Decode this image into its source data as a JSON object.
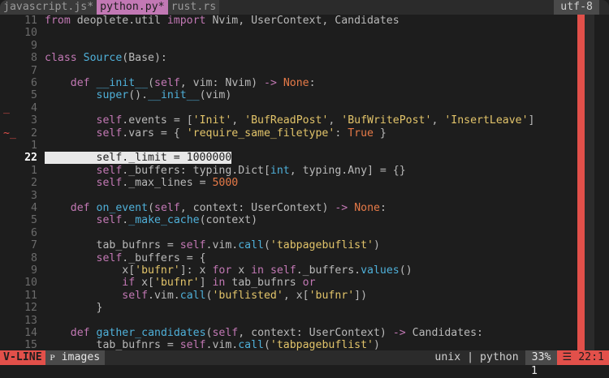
{
  "tabs": [
    {
      "label": "javascript.js",
      "modified": "*"
    },
    {
      "label": "python.py",
      "modified": "*"
    },
    {
      "label": "rust.rs",
      "modified": ""
    }
  ],
  "encoding": "utf-8",
  "lines": [
    {
      "num": "11",
      "sign": "",
      "tokens": [
        [
          "k",
          "from"
        ],
        [
          "o",
          " deoplete.util "
        ],
        [
          "k",
          "import"
        ],
        [
          "o",
          " Nvim, UserContext, Candidates"
        ]
      ]
    },
    {
      "num": "10",
      "sign": "",
      "tokens": []
    },
    {
      "num": "9",
      "sign": "",
      "tokens": []
    },
    {
      "num": "8",
      "sign": "",
      "tokens": [
        [
          "k",
          "class"
        ],
        [
          "o",
          " "
        ],
        [
          "f",
          "Source"
        ],
        [
          "o",
          "(Base):"
        ]
      ]
    },
    {
      "num": "7",
      "sign": "",
      "tokens": []
    },
    {
      "num": "6",
      "sign": "",
      "tokens": [
        [
          "o",
          "    "
        ],
        [
          "k",
          "def"
        ],
        [
          "o",
          " "
        ],
        [
          "f",
          "__init__"
        ],
        [
          "o",
          "("
        ],
        [
          "k",
          "self"
        ],
        [
          "o",
          ", vim: Nvim) "
        ],
        [
          "k",
          "->"
        ],
        [
          "o",
          " "
        ],
        [
          "c",
          "None"
        ],
        [
          "o",
          ":"
        ]
      ]
    },
    {
      "num": "5",
      "sign": "",
      "tokens": [
        [
          "o",
          "        "
        ],
        [
          "f",
          "super"
        ],
        [
          "o",
          "()."
        ],
        [
          "f",
          "__init__"
        ],
        [
          "o",
          "(vim)"
        ]
      ]
    },
    {
      "num": "4",
      "sign": "_",
      "tokens": []
    },
    {
      "num": "3",
      "sign": "",
      "tokens": [
        [
          "o",
          "        "
        ],
        [
          "k",
          "self"
        ],
        [
          "o",
          ".events = ["
        ],
        [
          "s",
          "'Init'"
        ],
        [
          "o",
          ", "
        ],
        [
          "s",
          "'BufReadPost'"
        ],
        [
          "o",
          ", "
        ],
        [
          "s",
          "'BufWritePost'"
        ],
        [
          "o",
          ", "
        ],
        [
          "s",
          "'InsertLeave'"
        ],
        [
          "o",
          "]"
        ]
      ]
    },
    {
      "num": "2",
      "sign": "~_",
      "tokens": [
        [
          "o",
          "        "
        ],
        [
          "k",
          "self"
        ],
        [
          "o",
          ".vars = { "
        ],
        [
          "s",
          "'require_same_filetype'"
        ],
        [
          "o",
          ": "
        ],
        [
          "c",
          "True"
        ],
        [
          "o",
          " }"
        ]
      ]
    },
    {
      "num": "1",
      "sign": "",
      "tokens": []
    },
    {
      "num": "22",
      "sign": "",
      "current": true,
      "tokens": [
        [
          "sel",
          "        self._limit = 1000000"
        ]
      ]
    },
    {
      "num": "1",
      "sign": "",
      "tokens": [
        [
          "o",
          "        "
        ],
        [
          "k",
          "self"
        ],
        [
          "o",
          "._buffers: typing.Dict["
        ],
        [
          "f",
          "int"
        ],
        [
          "o",
          ", typing.Any] = {}"
        ]
      ]
    },
    {
      "num": "2",
      "sign": "",
      "tokens": [
        [
          "o",
          "        "
        ],
        [
          "k",
          "self"
        ],
        [
          "o",
          "._max_lines = "
        ],
        [
          "c",
          "5000"
        ]
      ]
    },
    {
      "num": "3",
      "sign": "",
      "tokens": []
    },
    {
      "num": "4",
      "sign": "",
      "tokens": [
        [
          "o",
          "    "
        ],
        [
          "k",
          "def"
        ],
        [
          "o",
          " "
        ],
        [
          "f",
          "on_event"
        ],
        [
          "o",
          "("
        ],
        [
          "k",
          "self"
        ],
        [
          "o",
          ", context: UserContext) "
        ],
        [
          "k",
          "->"
        ],
        [
          "o",
          " "
        ],
        [
          "c",
          "None"
        ],
        [
          "o",
          ":"
        ]
      ]
    },
    {
      "num": "5",
      "sign": "",
      "tokens": [
        [
          "o",
          "        "
        ],
        [
          "k",
          "self"
        ],
        [
          "o",
          "."
        ],
        [
          "f",
          "_make_cache"
        ],
        [
          "o",
          "(context)"
        ]
      ]
    },
    {
      "num": "6",
      "sign": "",
      "tokens": []
    },
    {
      "num": "7",
      "sign": "",
      "tokens": [
        [
          "o",
          "        tab_bufnrs = "
        ],
        [
          "k",
          "self"
        ],
        [
          "o",
          ".vim."
        ],
        [
          "f",
          "call"
        ],
        [
          "o",
          "("
        ],
        [
          "s",
          "'tabpagebuflist'"
        ],
        [
          "o",
          ")"
        ]
      ]
    },
    {
      "num": "8",
      "sign": "",
      "tokens": [
        [
          "o",
          "        "
        ],
        [
          "k",
          "self"
        ],
        [
          "o",
          "._buffers = {"
        ]
      ]
    },
    {
      "num": "9",
      "sign": "",
      "tokens": [
        [
          "o",
          "            x["
        ],
        [
          "s",
          "'bufnr'"
        ],
        [
          "o",
          "]: x "
        ],
        [
          "k",
          "for"
        ],
        [
          "o",
          " x "
        ],
        [
          "k",
          "in"
        ],
        [
          "o",
          " "
        ],
        [
          "k",
          "self"
        ],
        [
          "o",
          "._buffers."
        ],
        [
          "f",
          "values"
        ],
        [
          "o",
          "()"
        ]
      ]
    },
    {
      "num": "10",
      "sign": "",
      "tokens": [
        [
          "o",
          "            "
        ],
        [
          "k",
          "if"
        ],
        [
          "o",
          " x["
        ],
        [
          "s",
          "'bufnr'"
        ],
        [
          "o",
          "] "
        ],
        [
          "k",
          "in"
        ],
        [
          "o",
          " tab_bufnrs "
        ],
        [
          "k",
          "or"
        ]
      ]
    },
    {
      "num": "11",
      "sign": "",
      "tokens": [
        [
          "o",
          "            "
        ],
        [
          "k",
          "self"
        ],
        [
          "o",
          ".vim."
        ],
        [
          "f",
          "call"
        ],
        [
          "o",
          "("
        ],
        [
          "s",
          "'buflisted'"
        ],
        [
          "o",
          ", x["
        ],
        [
          "s",
          "'bufnr'"
        ],
        [
          "o",
          "])"
        ]
      ]
    },
    {
      "num": "12",
      "sign": "",
      "tokens": [
        [
          "o",
          "        }"
        ]
      ]
    },
    {
      "num": "13",
      "sign": "",
      "tokens": []
    },
    {
      "num": "14",
      "sign": "",
      "tokens": [
        [
          "o",
          "    "
        ],
        [
          "k",
          "def"
        ],
        [
          "o",
          " "
        ],
        [
          "f",
          "gather_candidates"
        ],
        [
          "o",
          "("
        ],
        [
          "k",
          "self"
        ],
        [
          "o",
          ", context: UserContext) "
        ],
        [
          "k",
          "->"
        ],
        [
          "o",
          " Candidates:"
        ]
      ]
    },
    {
      "num": "15",
      "sign": "",
      "tokens": [
        [
          "o",
          "        tab_bufnrs = "
        ],
        [
          "k",
          "self"
        ],
        [
          "o",
          ".vim."
        ],
        [
          "f",
          "call"
        ],
        [
          "o",
          "("
        ],
        [
          "s",
          "'tabpagebuflist'"
        ],
        [
          "o",
          ")"
        ]
      ]
    }
  ],
  "status": {
    "mode": "V-LINE",
    "branch_icon": "branch-icon",
    "branch": "ᴘ images",
    "fileformat": "unix | python",
    "percent": "33%",
    "position_icon": "lines-icon",
    "position": "☰  22:1"
  },
  "cmdline": "1",
  "colors": {
    "accent_red": "#e2504a",
    "accent_magenta": "#c278b4",
    "string": "#e2c46a",
    "function": "#4fb0d9",
    "constant": "#e67a48",
    "background": "#1d1d1d"
  }
}
